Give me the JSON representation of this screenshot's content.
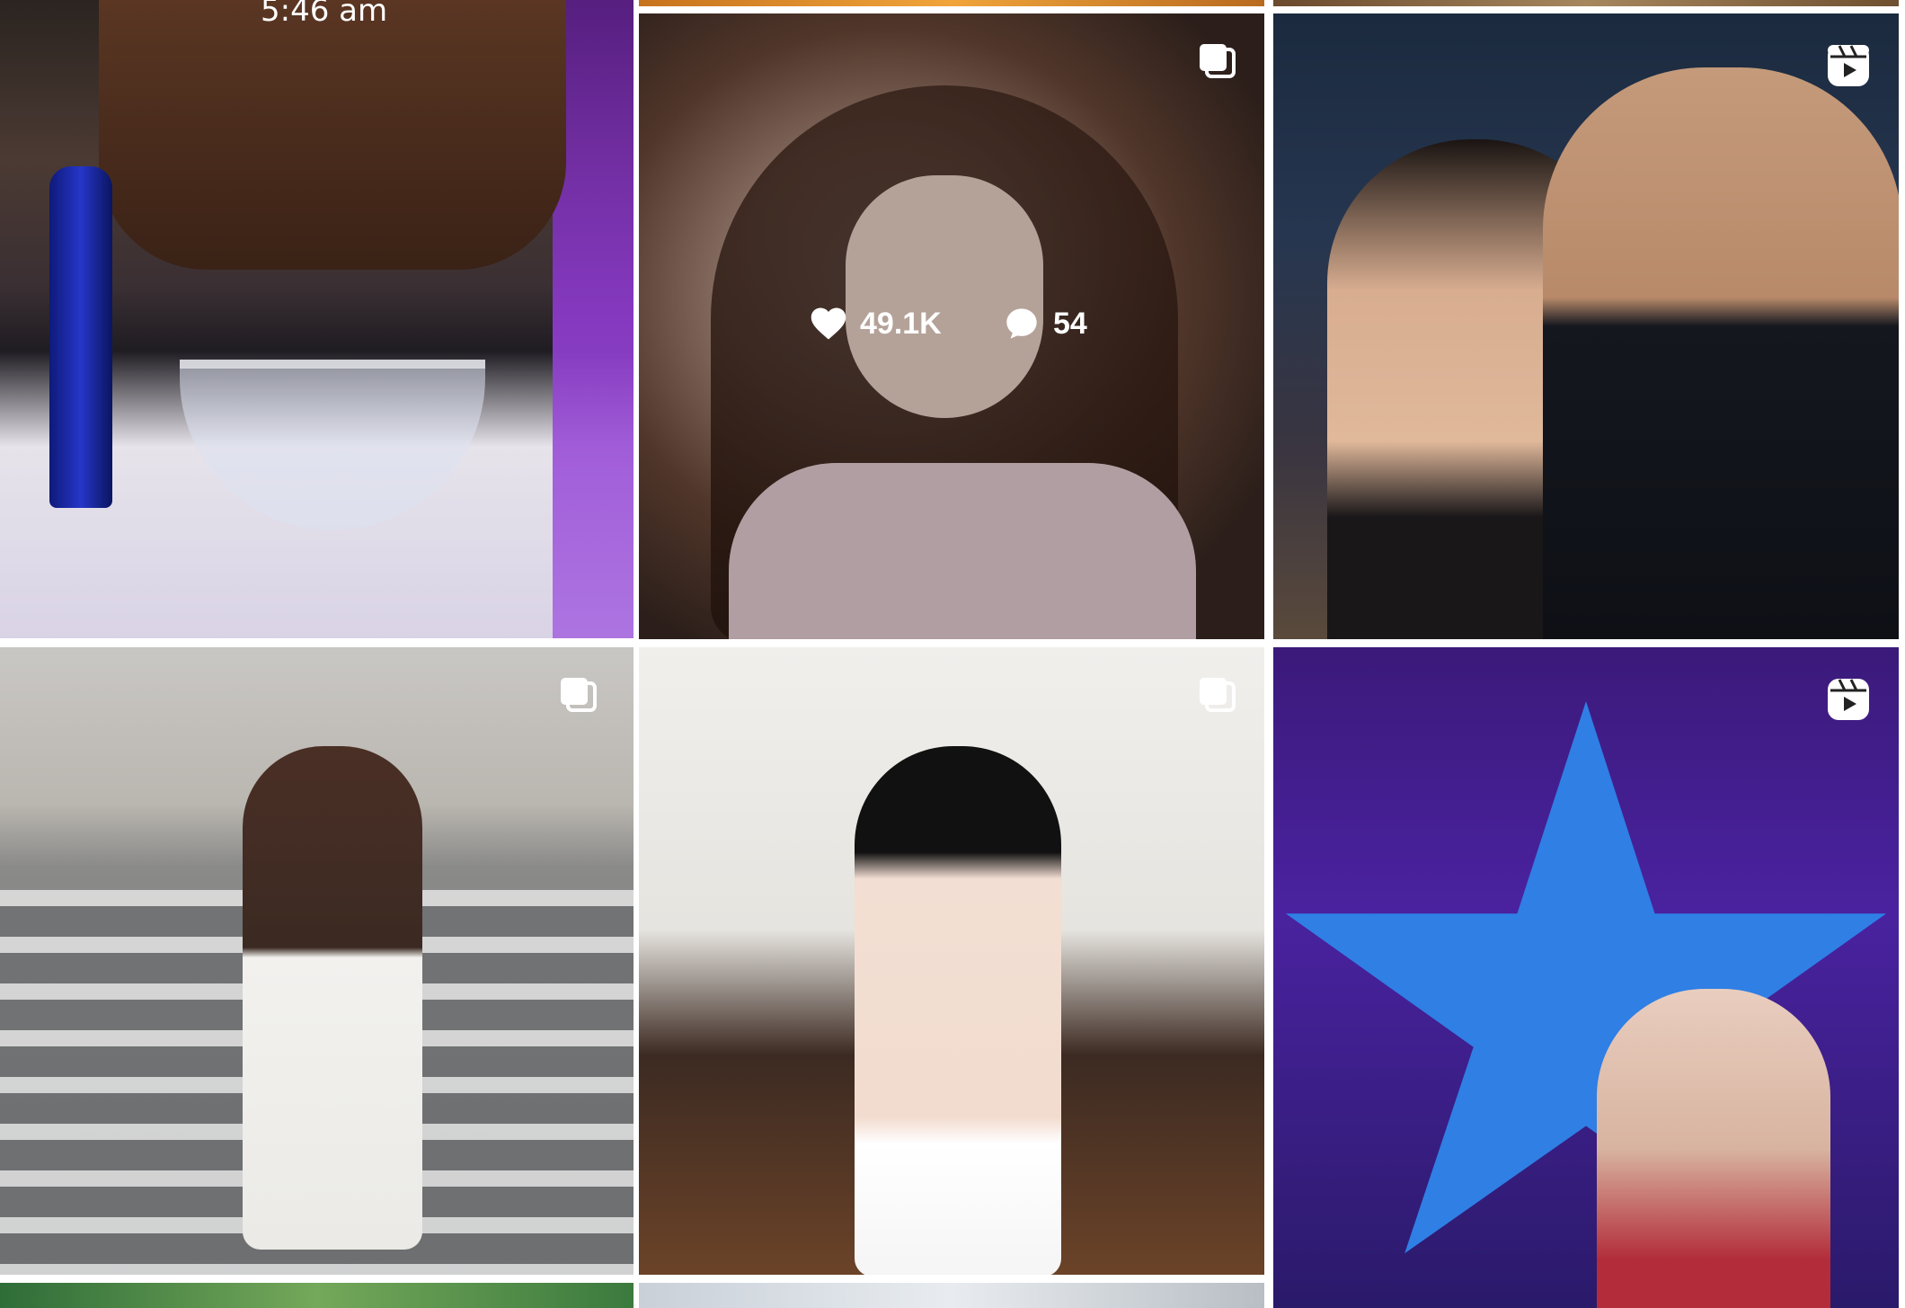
{
  "feed": {
    "posts": [
      {
        "id": "post-1",
        "timestamp_overlay": "5:46 am"
      },
      {
        "id": "post-2",
        "type": "carousel",
        "likes": "49.1K",
        "comments": "54"
      },
      {
        "id": "post-3",
        "type": "reel"
      },
      {
        "id": "post-4",
        "type": "carousel"
      },
      {
        "id": "post-5",
        "type": "carousel"
      },
      {
        "id": "post-6",
        "type": "reel"
      }
    ]
  },
  "icons": {
    "carousel": "carousel-icon",
    "reel": "reel-icon",
    "heart": "heart-icon",
    "comment": "comment-icon"
  }
}
